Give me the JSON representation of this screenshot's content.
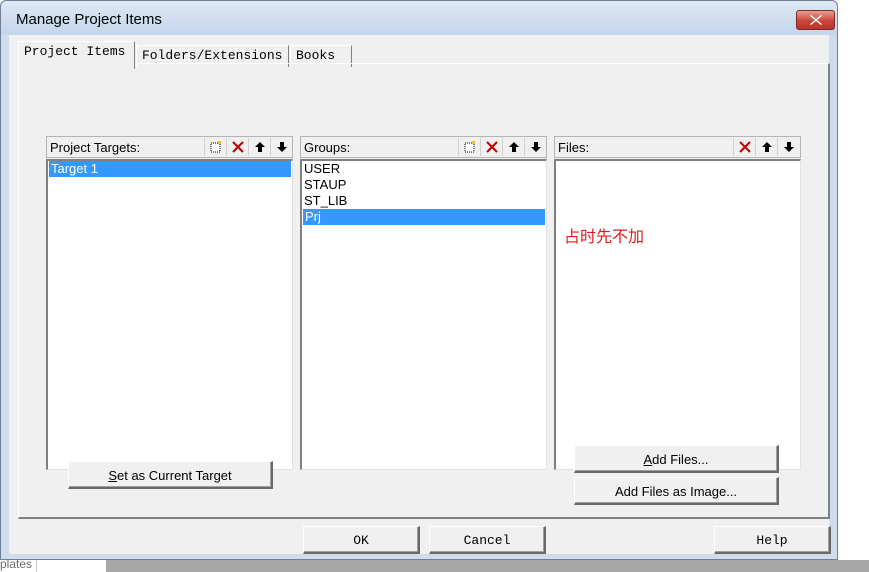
{
  "window": {
    "title": "Manage Project Items"
  },
  "tabs": [
    "Project Items",
    "Folders/Extensions",
    "Books"
  ],
  "project_targets": {
    "label": "Project Targets:",
    "items": [
      "Target 1"
    ],
    "selected": "Target 1"
  },
  "groups": {
    "label": "Groups:",
    "items": [
      "USER",
      "STAUP",
      "ST_LIB",
      "Prj"
    ],
    "selected": "Prj"
  },
  "files": {
    "label": "Files:",
    "items": [],
    "note": "占时先不加"
  },
  "buttons": {
    "set_current_target": {
      "accel": "S",
      "rest": "et as Current Target"
    },
    "add_files": {
      "accel": "A",
      "rest": "dd Files..."
    },
    "add_files_image": "Add Files as Image...",
    "ok": "OK",
    "cancel": "Cancel",
    "help": "Help"
  },
  "background": {
    "fragment": "plates"
  },
  "icons": {
    "new": "new-item-icon",
    "delete": "delete-icon",
    "up": "move-up-icon",
    "down": "move-down-icon",
    "close": "close-icon"
  },
  "colors": {
    "selection": "#3399ff",
    "delete_icon": "#c00000",
    "note": "#e01b1b",
    "close_button": "#c9463a"
  }
}
